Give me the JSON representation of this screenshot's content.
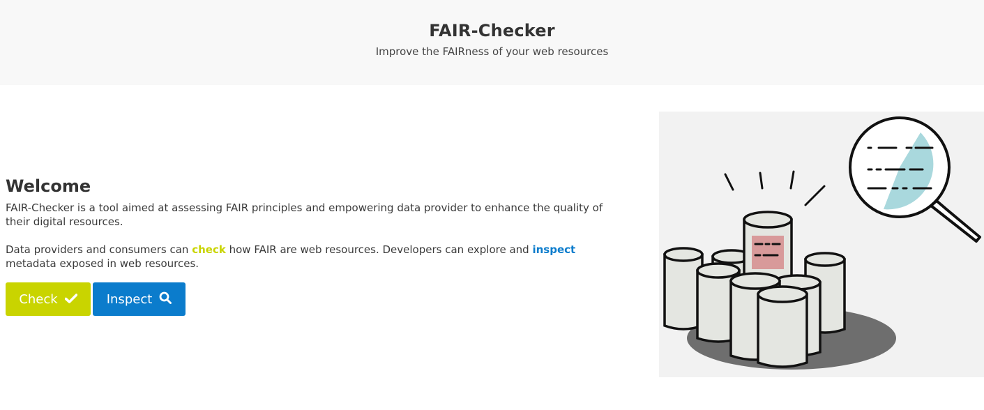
{
  "header": {
    "title": "FAIR-Checker",
    "subtitle": "Improve the FAIRness of your web resources"
  },
  "main": {
    "heading": "Welcome",
    "intro": "FAIR-Checker is a tool aimed at assessing FAIR principles and empowering data provider to enhance the quality of their digital resources.",
    "para2_part1": "Data providers and consumers can ",
    "para2_check": "check",
    "para2_part2": " how FAIR are web resources. Developers can explore and ",
    "para2_inspect": "inspect",
    "para2_part3": " metadata exposed in web resources."
  },
  "buttons": {
    "check_label": "Check",
    "check_icon": "checkmark-icon",
    "inspect_label": "Inspect",
    "inspect_icon": "search-icon"
  },
  "colors": {
    "check": "#c9d400",
    "inspect": "#0b7ccc",
    "header_bg": "#f8f8f8"
  },
  "illustration": {
    "icon": "database-magnifier-illustration"
  }
}
